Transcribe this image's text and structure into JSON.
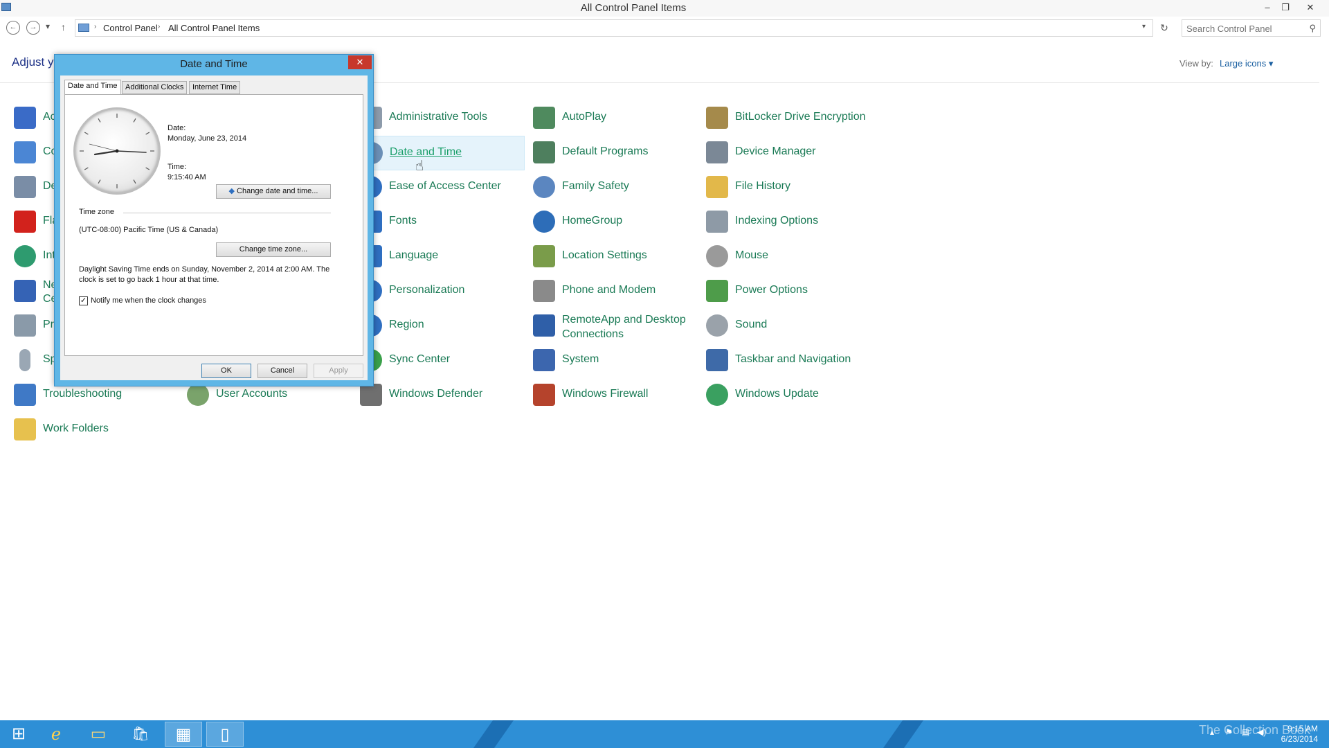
{
  "window": {
    "title": "All Control Panel Items",
    "minimize": "–",
    "restore": "❐",
    "close": "✕"
  },
  "address": {
    "back": "←",
    "forward": "→",
    "history": "▾",
    "up": "↑",
    "breadcrumb": [
      "Control Panel",
      "All Control Panel Items"
    ],
    "crumb_sep": "›",
    "dropdown": "▾",
    "refresh": "↻",
    "search_placeholder": "Search Control Panel",
    "search_icon": "⚲"
  },
  "header": {
    "adjust_text": "Adjust yo",
    "view_by_label": "View by:",
    "view_by_value": "Large icons ▾"
  },
  "items": {
    "col1": [
      {
        "label": "Ac",
        "icon": "action-center-icon",
        "color": "#3a6bc7"
      },
      {
        "label": "Co",
        "icon": "color-management-icon",
        "color": "#4b86d4"
      },
      {
        "label": "De",
        "icon": "devices-printers-icon",
        "color": "#7a8da6"
      },
      {
        "label": "Fla",
        "icon": "flash-player-icon",
        "color": "#d2221c"
      },
      {
        "label": "Int",
        "icon": "internet-options-icon",
        "color": "#2e9b6f"
      },
      {
        "label": "Ne",
        "label2": "Ce",
        "icon": "network-sharing-icon",
        "color": "#3563b5"
      },
      {
        "label": "Pr",
        "icon": "programs-features-icon",
        "color": "#8a9aa9"
      },
      {
        "label": "Sp",
        "icon": "speech-recognition-icon",
        "color": "#9aa7b4"
      },
      {
        "label": "Troubleshooting",
        "icon": "troubleshooting-icon",
        "color": "#3f79c6"
      },
      {
        "label": "Work Folders",
        "icon": "work-folders-icon",
        "color": "#e7c14e"
      }
    ],
    "col2": [
      {
        "label": "User Accounts",
        "icon": "user-accounts-icon",
        "color": "#7aa36b"
      }
    ],
    "col3": [
      {
        "label": "Administrative Tools",
        "icon": "administrative-tools-icon",
        "color": "#8d9bab"
      },
      {
        "label": "Date and Time",
        "icon": "date-time-icon",
        "color": "#6b8fb6"
      },
      {
        "label": "Ease of Access Center",
        "icon": "ease-of-access-icon",
        "color": "#2f6fc1"
      },
      {
        "label": "Fonts",
        "icon": "fonts-icon",
        "color": "#2f6fc1"
      },
      {
        "label": "Language",
        "icon": "language-icon",
        "color": "#2f6fc1"
      },
      {
        "label": "Personalization",
        "icon": "personalization-icon",
        "color": "#2f6fc1"
      },
      {
        "label": "Region",
        "icon": "region-icon",
        "color": "#2f6fc1"
      },
      {
        "label": "Sync Center",
        "icon": "sync-center-icon",
        "color": "#3aa14b"
      },
      {
        "label": "Windows Defender",
        "icon": "windows-defender-icon",
        "color": "#6f6f6f"
      }
    ],
    "col4": [
      {
        "label": "AutoPlay",
        "icon": "autoplay-icon",
        "color": "#4f8a5e"
      },
      {
        "label": "Default Programs",
        "icon": "default-programs-icon",
        "color": "#4e7f5e"
      },
      {
        "label": "Family Safety",
        "icon": "family-safety-icon",
        "color": "#5b86c0"
      },
      {
        "label": "HomeGroup",
        "icon": "homegroup-icon",
        "color": "#2d6db8"
      },
      {
        "label": "Location Settings",
        "icon": "location-settings-icon",
        "color": "#7a9c4a"
      },
      {
        "label": "Phone and Modem",
        "icon": "phone-modem-icon",
        "color": "#8a8a8a"
      },
      {
        "label": "RemoteApp and Desktop Connections",
        "icon": "remoteapp-icon",
        "color": "#2f5fa8"
      },
      {
        "label": "System",
        "icon": "system-icon",
        "color": "#3c66ae"
      },
      {
        "label": "Windows Firewall",
        "icon": "windows-firewall-icon",
        "color": "#b5432c"
      }
    ],
    "col5": [
      {
        "label": "BitLocker Drive Encryption",
        "icon": "bitlocker-icon",
        "color": "#a58a4b"
      },
      {
        "label": "Device Manager",
        "icon": "device-manager-icon",
        "color": "#7b8896"
      },
      {
        "label": "File History",
        "icon": "file-history-icon",
        "color": "#e2b84a"
      },
      {
        "label": "Indexing Options",
        "icon": "indexing-options-icon",
        "color": "#8e9aa6"
      },
      {
        "label": "Mouse",
        "icon": "mouse-icon",
        "color": "#9a9a9a"
      },
      {
        "label": "Power Options",
        "icon": "power-options-icon",
        "color": "#4e9c4a"
      },
      {
        "label": "Sound",
        "icon": "sound-icon",
        "color": "#9aa2aa"
      },
      {
        "label": "Taskbar and Navigation",
        "icon": "taskbar-navigation-icon",
        "color": "#3e6aa8"
      },
      {
        "label": "Windows Update",
        "icon": "windows-update-icon",
        "color": "#3aa060"
      }
    ]
  },
  "dialog": {
    "title": "Date and Time",
    "close": "✕",
    "tabs": [
      "Date and Time",
      "Additional Clocks",
      "Internet Time"
    ],
    "date_label": "Date:",
    "date_value": "Monday, June 23, 2014",
    "time_label": "Time:",
    "time_value": "9:15:40 AM",
    "change_datetime": "Change date and time...",
    "timezone_header": "Time zone",
    "timezone_value": "(UTC-08:00) Pacific Time (US & Canada)",
    "change_timezone": "Change time zone...",
    "dst_line1": "Daylight Saving Time ends on Sunday, November 2, 2014 at 2:00 AM. The",
    "dst_line2": "clock is set to go back 1 hour at that time.",
    "notify_label": "Notify me when the clock changes",
    "notify_check": "✓",
    "ok": "OK",
    "cancel": "Cancel",
    "apply": "Apply"
  },
  "taskbar": {
    "start": "⊞",
    "ie": "e",
    "explorer": "▭",
    "store": "🛍",
    "controlpanel": "▦",
    "notepad": "▯",
    "watermark": "The Collection Book",
    "tray_up": "▴",
    "tray_flag": "⚑",
    "tray_net": "▤",
    "tray_vol": "◀)",
    "clock_time": "9:15 AM",
    "clock_date": "6/23/2014"
  }
}
